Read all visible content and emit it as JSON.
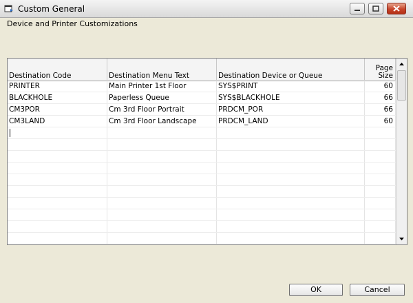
{
  "window": {
    "title": "Custom General"
  },
  "subtitle": "Device and Printer Customizations",
  "table": {
    "headers": {
      "code": "Destination Code",
      "menu_text": "Destination Menu Text",
      "device": "Destination Device or Queue",
      "page_size_1": "Page",
      "page_size_2": "Size"
    },
    "rows": [
      {
        "code": "PRINTER",
        "menu_text": "Main Printer 1st Floor",
        "device": "SYS$PRINT",
        "page_size": "60"
      },
      {
        "code": "BLACKHOLE",
        "menu_text": "Paperless Queue",
        "device": "SYS$BLACKHOLE",
        "page_size": "66"
      },
      {
        "code": "CM3POR",
        "menu_text": "Cm 3rd Floor Portrait",
        "device": "PRDCM_POR",
        "page_size": "66"
      },
      {
        "code": "CM3LAND",
        "menu_text": "Cm 3rd Floor Landscape",
        "device": "PRDCM_LAND",
        "page_size": "60"
      }
    ]
  },
  "buttons": {
    "ok": "OK",
    "cancel": "Cancel"
  }
}
